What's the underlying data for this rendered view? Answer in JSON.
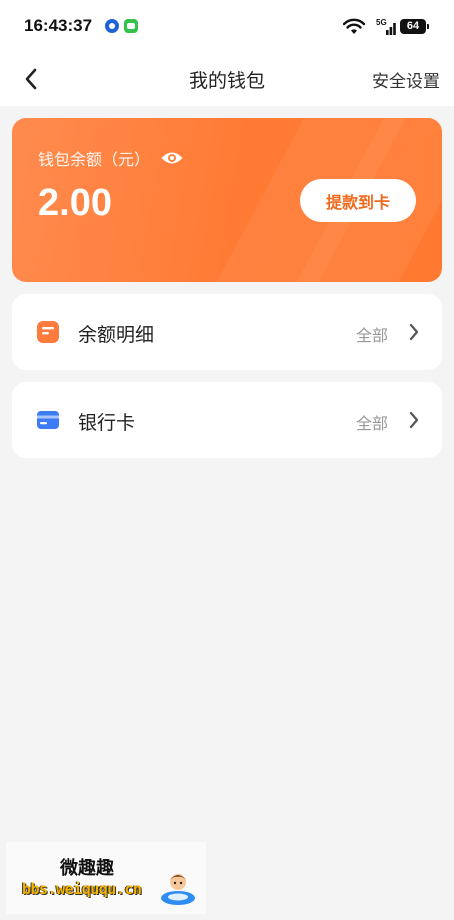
{
  "status_bar": {
    "time": "16:43:37",
    "network_label": "5G",
    "battery": "64"
  },
  "nav": {
    "title": "我的钱包",
    "action": "安全设置",
    "back_icon": "chevron-left-icon"
  },
  "balance": {
    "label": "钱包余额（元）",
    "amount": "2.00",
    "withdraw_label": "提款到卡",
    "accent_color": "#ff7a30",
    "button_text_color": "#f06a1e"
  },
  "items": [
    {
      "label": "余额明细",
      "value": "全部",
      "icon": "statement-icon"
    },
    {
      "label": "银行卡",
      "value": "全部",
      "icon": "bank-card-icon"
    }
  ],
  "watermark": {
    "title": "微趣趣",
    "url": "bbs.weiququ.cn"
  }
}
